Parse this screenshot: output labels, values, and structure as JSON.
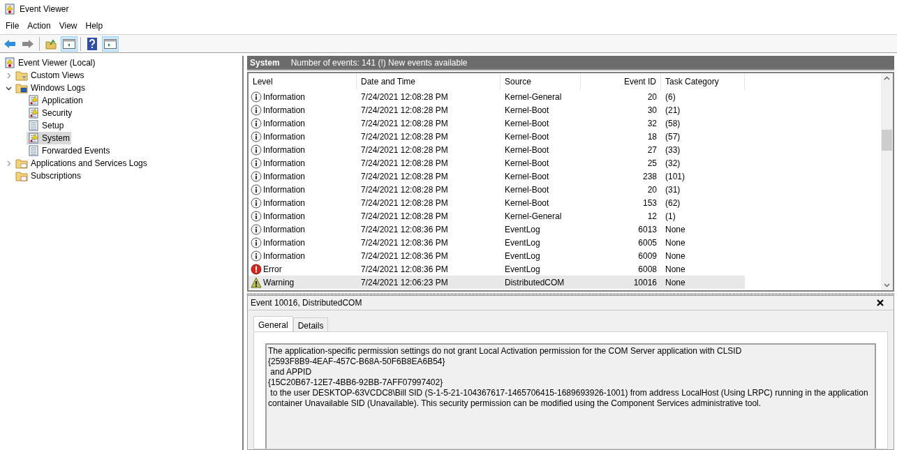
{
  "window": {
    "title": "Event Viewer"
  },
  "menu": [
    "File",
    "Action",
    "View",
    "Help"
  ],
  "toolbar": [
    {
      "kind": "back",
      "pressed": false
    },
    {
      "kind": "forward",
      "pressed": false
    },
    {
      "kind": "folder-up",
      "pressed": false
    },
    {
      "kind": "pane-left",
      "pressed": true
    },
    {
      "kind": "help",
      "pressed": false
    },
    {
      "kind": "pane-right",
      "pressed": true
    }
  ],
  "tree": [
    {
      "label": "Event Viewer (Local)",
      "kind": "viewer",
      "selected": false,
      "children": [
        {
          "label": "Custom Views",
          "kind": "folder-filter",
          "expanded": false,
          "selected": false
        },
        {
          "label": "Windows Logs",
          "kind": "folder-logs",
          "expanded": true,
          "selected": false,
          "children": [
            {
              "label": "Application",
              "kind": "log-alert",
              "selected": false
            },
            {
              "label": "Security",
              "kind": "log-alert",
              "selected": false
            },
            {
              "label": "Setup",
              "kind": "log",
              "selected": false
            },
            {
              "label": "System",
              "kind": "log-alert",
              "selected": true
            },
            {
              "label": "Forwarded Events",
              "kind": "log",
              "selected": false
            }
          ]
        },
        {
          "label": "Applications and Services Logs",
          "kind": "folder",
          "expanded": false,
          "selected": false
        },
        {
          "label": "Subscriptions",
          "kind": "folder-subs",
          "selected": false
        }
      ]
    }
  ],
  "pane_header": {
    "title": "System",
    "info": "Number of events: 141 (!) New events available"
  },
  "table": {
    "columns": [
      "Level",
      "Date and Time",
      "Source",
      "Event ID",
      "Task Category"
    ],
    "rows": [
      {
        "kind": "info",
        "cells": [
          "Information",
          "7/24/2021 12:08:28 PM",
          "Kernel-General",
          "20",
          "(6)"
        ],
        "selected": false
      },
      {
        "kind": "info",
        "cells": [
          "Information",
          "7/24/2021 12:08:28 PM",
          "Kernel-Boot",
          "30",
          "(21)"
        ],
        "selected": false
      },
      {
        "kind": "info",
        "cells": [
          "Information",
          "7/24/2021 12:08:28 PM",
          "Kernel-Boot",
          "32",
          "(58)"
        ],
        "selected": false
      },
      {
        "kind": "info",
        "cells": [
          "Information",
          "7/24/2021 12:08:28 PM",
          "Kernel-Boot",
          "18",
          "(57)"
        ],
        "selected": false
      },
      {
        "kind": "info",
        "cells": [
          "Information",
          "7/24/2021 12:08:28 PM",
          "Kernel-Boot",
          "27",
          "(33)"
        ],
        "selected": false
      },
      {
        "kind": "info",
        "cells": [
          "Information",
          "7/24/2021 12:08:28 PM",
          "Kernel-Boot",
          "25",
          "(32)"
        ],
        "selected": false
      },
      {
        "kind": "info",
        "cells": [
          "Information",
          "7/24/2021 12:08:28 PM",
          "Kernel-Boot",
          "238",
          "(101)"
        ],
        "selected": false
      },
      {
        "kind": "info",
        "cells": [
          "Information",
          "7/24/2021 12:08:28 PM",
          "Kernel-Boot",
          "20",
          "(31)"
        ],
        "selected": false
      },
      {
        "kind": "info",
        "cells": [
          "Information",
          "7/24/2021 12:08:28 PM",
          "Kernel-Boot",
          "153",
          "(62)"
        ],
        "selected": false
      },
      {
        "kind": "info",
        "cells": [
          "Information",
          "7/24/2021 12:08:28 PM",
          "Kernel-General",
          "12",
          "(1)"
        ],
        "selected": false
      },
      {
        "kind": "info",
        "cells": [
          "Information",
          "7/24/2021 12:08:36 PM",
          "EventLog",
          "6013",
          "None"
        ],
        "selected": false
      },
      {
        "kind": "info",
        "cells": [
          "Information",
          "7/24/2021 12:08:36 PM",
          "EventLog",
          "6005",
          "None"
        ],
        "selected": false
      },
      {
        "kind": "info",
        "cells": [
          "Information",
          "7/24/2021 12:08:36 PM",
          "EventLog",
          "6009",
          "None"
        ],
        "selected": false
      },
      {
        "kind": "error",
        "cells": [
          "Error",
          "7/24/2021 12:08:36 PM",
          "EventLog",
          "6008",
          "None"
        ],
        "selected": false
      },
      {
        "kind": "warning",
        "cells": [
          "Warning",
          "7/24/2021 12:06:23 PM",
          "DistributedCOM",
          "10016",
          "None"
        ],
        "selected": true
      }
    ]
  },
  "detail": {
    "title": "Event 10016, DistributedCOM",
    "tabs": [
      {
        "label": "General",
        "selected": true
      },
      {
        "label": "Details",
        "selected": false
      }
    ],
    "description": [
      "The application-specific permission settings do not grant Local Activation permission for the COM Server application with CLSID",
      "{2593F8B9-4EAF-457C-B68A-50F6B8EA6B54}",
      " and APPID",
      "{15C20B67-12E7-4BB6-92BB-7AFF07997402}",
      " to the user DESKTOP-63VCDC8\\Bill SID (S-1-5-21-104367617-1465706415-1689693926-1001) from address LocalHost (Using LRPC) running in the application container Unavailable SID (Unavailable). This security permission can be modified using the Component Services administrative tool."
    ]
  }
}
